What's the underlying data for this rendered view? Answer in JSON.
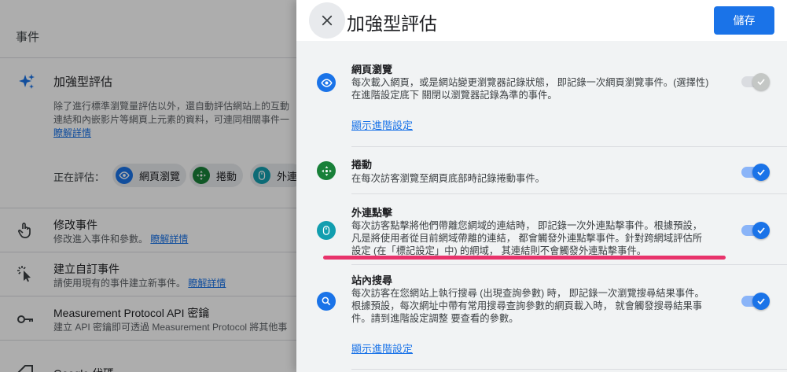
{
  "colors": {
    "primary": "#1a73e8",
    "highlight": "#e8336b",
    "scrim": "rgba(0,0,0,0.32)"
  },
  "background": {
    "section_title": "事件",
    "enhanced": {
      "title": "加強型評估",
      "desc_line1": "除了進行標準瀏覽量評估以外，還自動評估網站上的互動",
      "desc_line2": "連結和內嵌影片等網頁上元素的資料，可連同相關事件一",
      "learn_more": "瞭解詳情",
      "measuring_label": "正在評估：",
      "chips": [
        {
          "label": "網頁瀏覽",
          "icon": "eye-icon"
        },
        {
          "label": "捲動",
          "icon": "scroll-arrows-icon"
        },
        {
          "label": "外連",
          "icon": "mouse-icon"
        }
      ]
    },
    "rows": [
      {
        "title": "修改事件",
        "desc": "修改進入事件和參數。",
        "link": "瞭解詳情",
        "icon": "touch-icon"
      },
      {
        "title": "建立自訂事件",
        "desc": "請使用現有的事件建立新事件。",
        "link": "瞭解詳情",
        "icon": "cursor-click-icon"
      },
      {
        "title": "Measurement Protocol API 密鑰",
        "desc": "建立 API 密鑰即可透過 Measurement Protocol 將其他事",
        "link": "",
        "icon": "key-icon"
      },
      {
        "title": "Google 代碼",
        "desc": "",
        "link": "",
        "icon": "tag-icon"
      }
    ]
  },
  "panel": {
    "title": "加強型評估",
    "save_label": "儲存",
    "items": [
      {
        "title": "網頁瀏覽",
        "desc_lines": [
          "每次載入網頁，或是網站變更瀏覽器記錄狀態， 即記錄一次網頁瀏覽事件。(選擇性)",
          "在進階設定底下 關閉以瀏覽器記錄為準的事件。"
        ],
        "link": "顯示進階設定",
        "icon": "eye-icon",
        "enabled": false
      },
      {
        "title": "捲動",
        "desc_lines": [
          "在每次訪客瀏覽至網頁底部時記錄捲動事件。"
        ],
        "link": "",
        "icon": "scroll-arrows-icon",
        "enabled": true
      },
      {
        "title": "外連點擊",
        "desc_lines": [
          "每次訪客點擊將他們帶離您網域的連結時， 即記錄一次外連點擊事件。根據預設，",
          "凡是將使用者從目前網域帶離的連結， 都會觸發外連點擊事件。針對跨網域評估所",
          "設定 (在「標記設定」中) 的網域， 其連結則不會觸發外連點擊事件。"
        ],
        "link": "",
        "icon": "mouse-icon",
        "enabled": true
      },
      {
        "title": "站內搜尋",
        "desc_lines": [
          "每次訪客在您網站上執行搜尋 (出現查詢參數) 時， 即記錄一次瀏覽搜尋結果事件。",
          "根據預設，每次網址中帶有常用搜尋查詢參數的網頁載入時， 就會觸發搜尋結果事",
          "件。請到進階設定調整 要查看的參數。"
        ],
        "link": "顯示進階設定",
        "icon": "search-icon",
        "enabled": true
      }
    ]
  }
}
